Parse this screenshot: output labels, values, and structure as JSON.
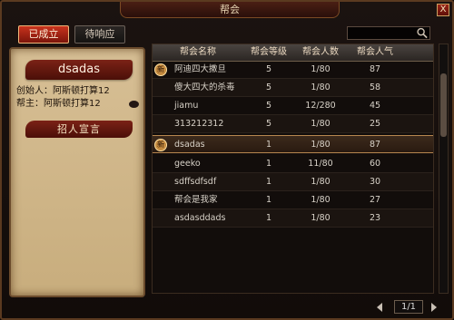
{
  "window": {
    "title": "帮会",
    "close_label": "X"
  },
  "tabs": [
    {
      "label": "已成立",
      "active": true
    },
    {
      "label": "待响应",
      "active": false
    }
  ],
  "search": {
    "value": ""
  },
  "guild_panel": {
    "name": "dsadas",
    "founder_label": "创始人：",
    "founder_value": "阿斯顿打算12",
    "leader_label": "帮主：",
    "leader_value": "阿斯顿打算12",
    "recruit_label": "招人宣言"
  },
  "table": {
    "columns": [
      "帮会名称",
      "帮会等级",
      "帮会人数",
      "帮会人气"
    ],
    "rows": [
      {
        "name": "阿迪四大撒旦",
        "level": "5",
        "members": "1/80",
        "popularity": "87",
        "is_new": true
      },
      {
        "name": "傻大四大的杀毒",
        "level": "5",
        "members": "1/80",
        "popularity": "58",
        "is_new": false
      },
      {
        "name": "jiamu",
        "level": "5",
        "members": "12/280",
        "popularity": "45",
        "is_new": false
      },
      {
        "name": "313212312",
        "level": "5",
        "members": "1/80",
        "popularity": "25",
        "is_new": false
      },
      {
        "name": "dsadas",
        "level": "1",
        "members": "1/80",
        "popularity": "87",
        "is_new": true,
        "selected": true
      },
      {
        "name": "geeko",
        "level": "1",
        "members": "11/80",
        "popularity": "60",
        "is_new": false
      },
      {
        "name": "sdffsdfsdf",
        "level": "1",
        "members": "1/80",
        "popularity": "30",
        "is_new": false
      },
      {
        "name": "帮会是我家",
        "level": "1",
        "members": "1/80",
        "popularity": "27",
        "is_new": false
      },
      {
        "name": "asdasddads",
        "level": "1",
        "members": "1/80",
        "popularity": "23",
        "is_new": false
      }
    ],
    "new_badge": "新"
  },
  "pagination": {
    "text": "1/1"
  },
  "colors": {
    "accent": "#c8321d",
    "gold": "#b7874f"
  }
}
